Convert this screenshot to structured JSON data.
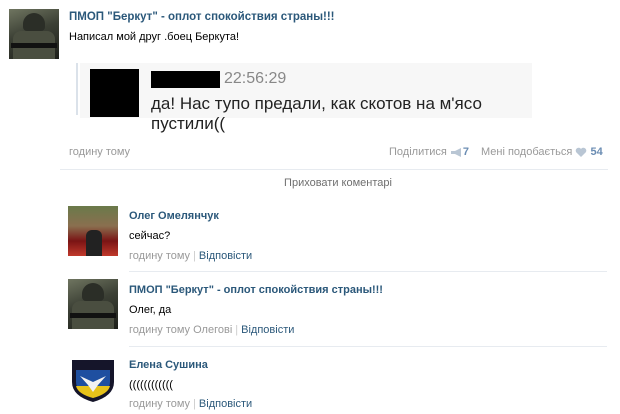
{
  "post": {
    "author": "ПМОП \"Беркут\" - оплот спокойствия страны!!!",
    "text": "Написал мой друг .боец Беркута!",
    "quote": {
      "time": "22:56:29",
      "message": "да! Нас тупо предали, как скотов на м'ясо пустили(("
    },
    "time": "годину тому",
    "share_label": "Поділитися",
    "share_count": "7",
    "like_label": "Мені подобається",
    "like_count": "54"
  },
  "hide_comments_label": "Приховати коментарі",
  "comments": [
    {
      "author": "Олег Омелянчук",
      "text": "сейчас?",
      "time": "годину тому",
      "reply_to": "",
      "reply_label": "Відповісти"
    },
    {
      "author": "ПМОП \"Беркут\" - оплот спокойствия страны!!!",
      "text": "Олег, да",
      "time": "годину тому",
      "reply_to": "Олегові",
      "reply_label": "Відповісти"
    },
    {
      "author": "Елена Сушина",
      "text": "((((((((((((",
      "time": "годину тому",
      "reply_to": "",
      "reply_label": "Відповісти"
    }
  ],
  "icons": {
    "share": "megaphone-icon",
    "like": "heart-icon"
  },
  "colors": {
    "link": "#2b587a",
    "count": "#6b8db3",
    "muted": "#999999"
  }
}
